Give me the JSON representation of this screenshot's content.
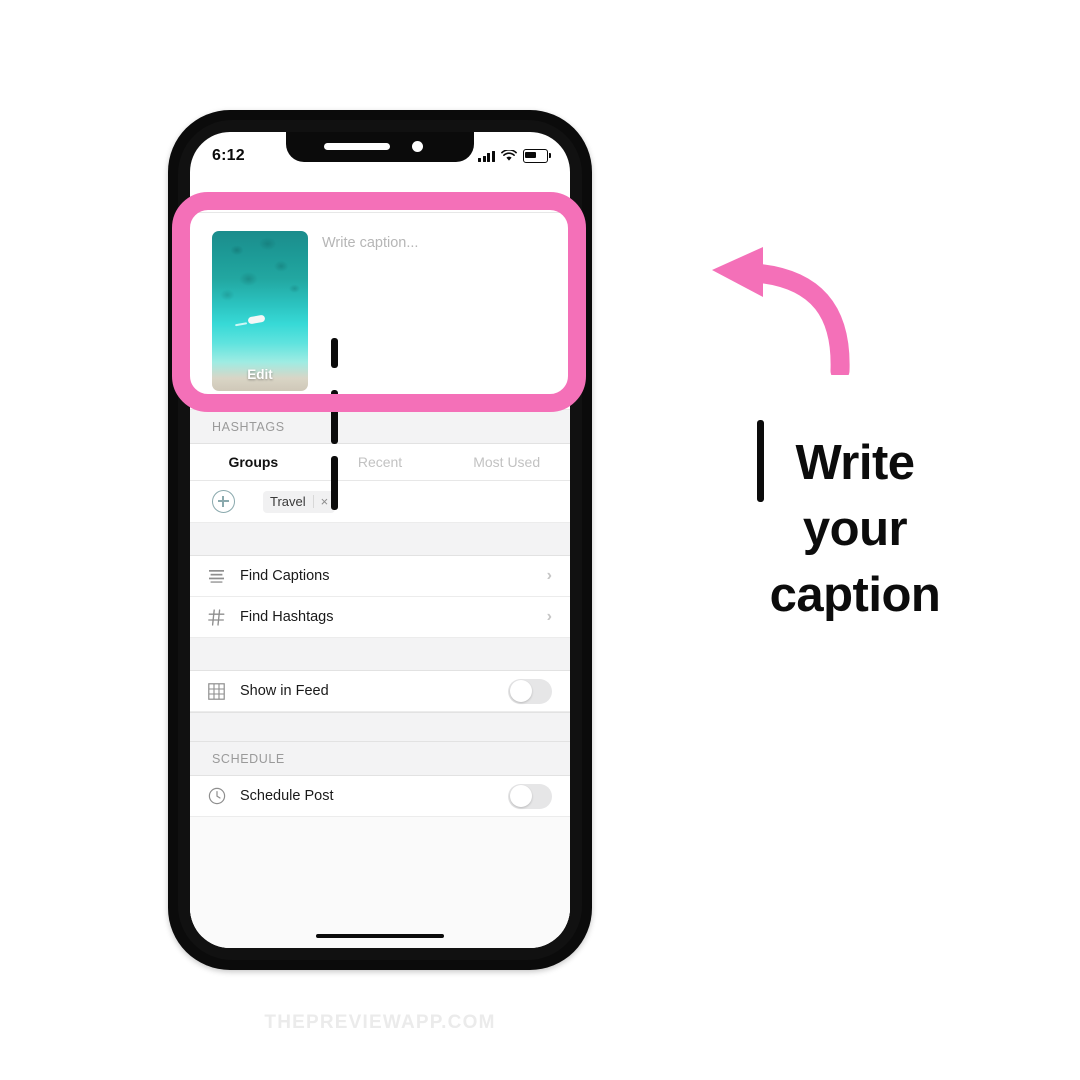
{
  "phone": {
    "status_bar": {
      "time": "6:12",
      "signal_icon": "cellular-bars-icon",
      "wifi_icon": "wifi-icon",
      "battery_icon": "battery-icon"
    },
    "caption_section": {
      "thumbnail_alt": "beach-aerial-thumbnail",
      "edit_label": "Edit",
      "caption_placeholder": "Write caption..."
    },
    "hashtags_section": {
      "header": "HASHTAGS",
      "tabs": [
        {
          "label": "Groups",
          "active": true
        },
        {
          "label": "Recent",
          "active": false
        },
        {
          "label": "Most Used",
          "active": false
        }
      ],
      "add_icon": "plus-circle-icon",
      "chips": [
        {
          "label": "Travel",
          "remove_icon": "close-icon",
          "remove_glyph": "×"
        }
      ]
    },
    "actions": [
      {
        "label": "Find Captions",
        "icon": "lines-icon",
        "chevron": "›"
      },
      {
        "label": "Find Hashtags",
        "icon": "hash-icon",
        "chevron": "›"
      }
    ],
    "feed_row": {
      "label": "Show in Feed",
      "icon": "grid-icon",
      "toggle_on": false
    },
    "schedule_section": {
      "header": "SCHEDULE",
      "row": {
        "label": "Schedule Post",
        "icon": "clock-icon",
        "toggle_on": false
      }
    },
    "home_indicator": "home-indicator"
  },
  "annotation": {
    "arrow_icon": "curved-arrow-left-icon",
    "highlight_color": "#f470b8",
    "lines": [
      "Write",
      "your",
      "caption"
    ]
  },
  "watermark": "THEPREVIEWAPP.COM"
}
